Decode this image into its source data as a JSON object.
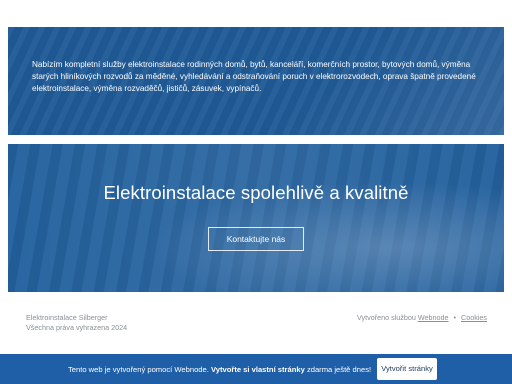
{
  "services": {
    "description": "Nabízím kompletní služby elektroinstalace rodinných domů, bytů, kanceláří, komerčních prostor, bytových domů, výměna starých hliníkových rozvodů za měděné, vyhledávání a odstraňování poruch v elektrorozvodech, oprava špatně provedené elektroinstalace, výměna rozvaděčů, jističů, zásuvek, vypínačů."
  },
  "hero": {
    "title": "Elektroinstalace spolehlivě a kvalitně",
    "cta_label": "Kontaktujte nás"
  },
  "footer": {
    "company": "Elektroinstalace Silberger",
    "rights": "Všechna práva vyhrazena 2024",
    "created_prefix": "Vytvořeno službou",
    "webnode_link": "Webnode",
    "separator": "•",
    "cookies_link": "Cookies"
  },
  "banner": {
    "text_prefix": "Tento web je vytvořený pomocí Webnode.",
    "text_bold": "Vytvořte si vlastní stránky",
    "text_suffix": "zdarma ještě dnes!",
    "button_label": "Vytvořit stránky"
  },
  "colors": {
    "panel_blue": "#1f5a96",
    "banner_blue": "#1f5fa8",
    "footer_text": "#8a8f96"
  }
}
